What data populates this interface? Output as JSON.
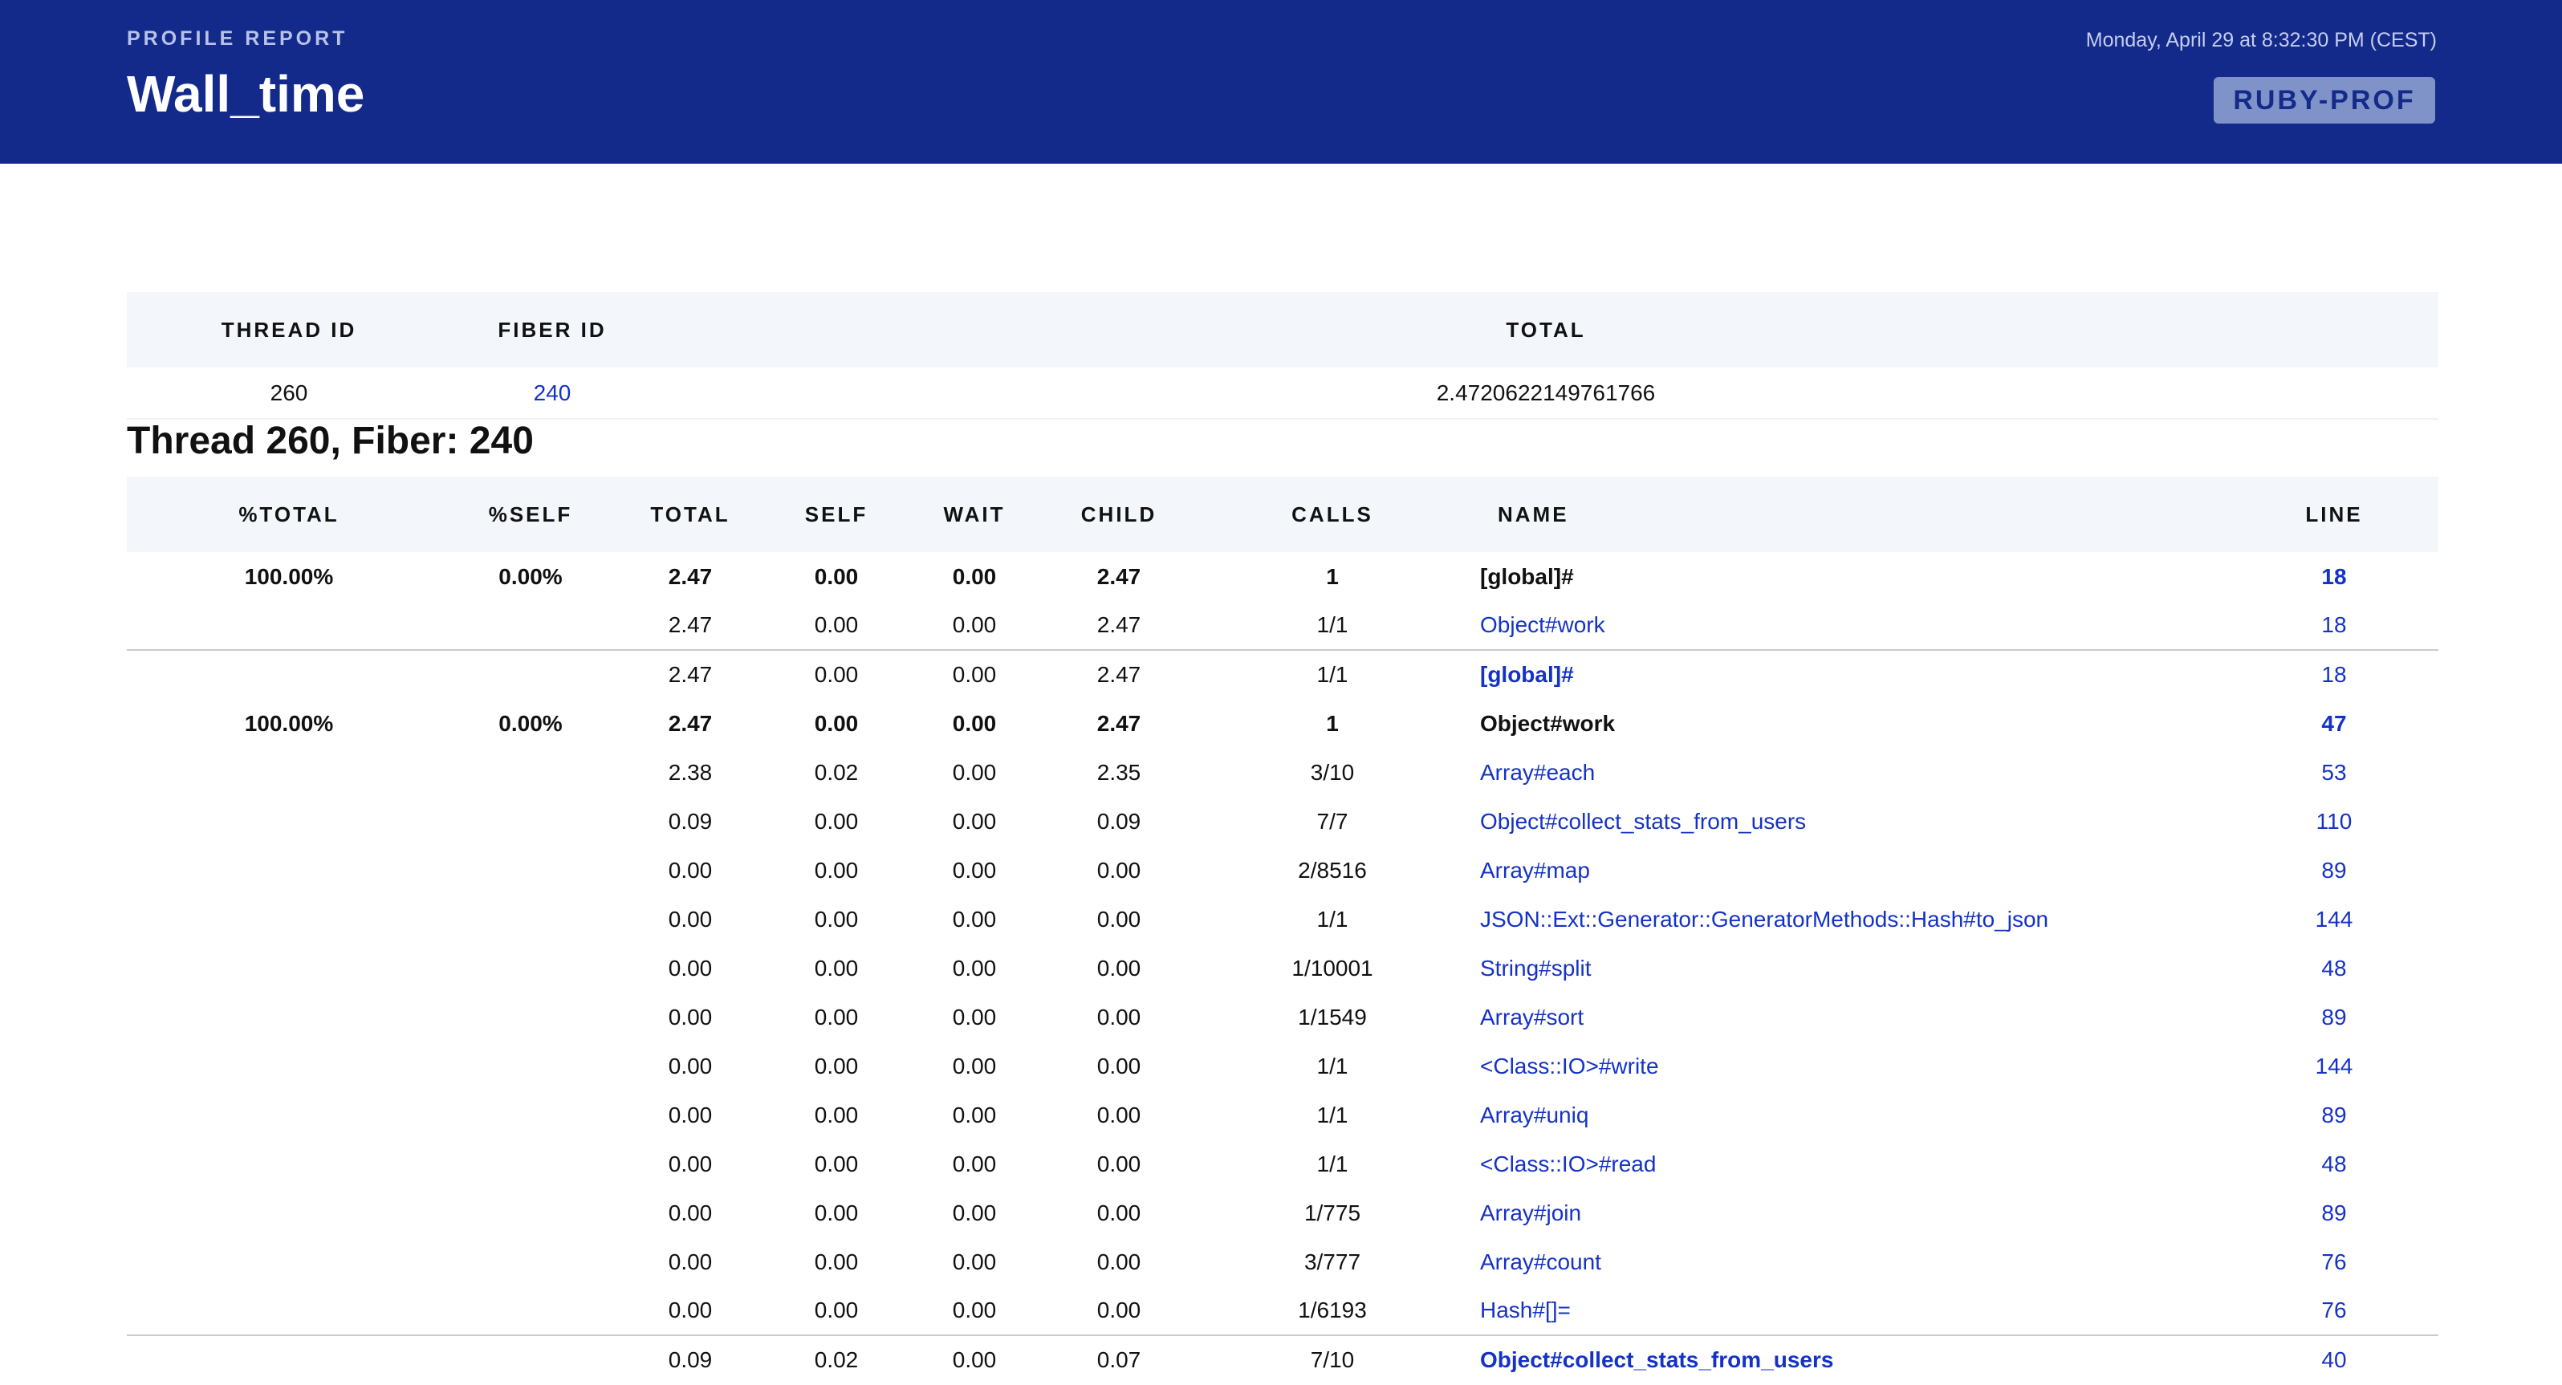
{
  "header": {
    "kicker": "PROFILE REPORT",
    "title": "Wall_time",
    "date": "Monday, April 29 at 8:32:30 PM (CEST)",
    "logo": "RUBY-PROF"
  },
  "thread_table": {
    "headers": [
      "THREAD ID",
      "FIBER ID",
      "TOTAL"
    ],
    "row": {
      "thread_id": "260",
      "fiber_id": "240",
      "total": "2.4720622149761766"
    }
  },
  "section_title": "Thread 260, Fiber: 240",
  "profile_table": {
    "headers": {
      "total_pct": "%TOTAL",
      "self_pct": "%SELF",
      "total": "TOTAL",
      "self": "SELF",
      "wait": "WAIT",
      "child": "CHILD",
      "calls": "CALLS",
      "name": "NAME",
      "line": "LINE"
    },
    "rows": [
      {
        "pct_total": "100.00%",
        "pct_self": "0.00%",
        "total": "2.47",
        "self": "0.00",
        "wait": "0.00",
        "child": "2.47",
        "calls": "1",
        "name": "[global]#",
        "line": "18"
      },
      {
        "pct_total": "",
        "pct_self": "",
        "total": "2.47",
        "self": "0.00",
        "wait": "0.00",
        "child": "2.47",
        "calls": "1/1",
        "name": "Object#work",
        "line": "18"
      },
      {
        "pct_total": "",
        "pct_self": "",
        "total": "2.47",
        "self": "0.00",
        "wait": "0.00",
        "child": "2.47",
        "calls": "1/1",
        "name": "[global]#",
        "line": "18"
      },
      {
        "pct_total": "100.00%",
        "pct_self": "0.00%",
        "total": "2.47",
        "self": "0.00",
        "wait": "0.00",
        "child": "2.47",
        "calls": "1",
        "name": "Object#work",
        "line": "47"
      },
      {
        "pct_total": "",
        "pct_self": "",
        "total": "2.38",
        "self": "0.02",
        "wait": "0.00",
        "child": "2.35",
        "calls": "3/10",
        "name": "Array#each",
        "line": "53"
      },
      {
        "pct_total": "",
        "pct_self": "",
        "total": "0.09",
        "self": "0.00",
        "wait": "0.00",
        "child": "0.09",
        "calls": "7/7",
        "name": "Object#collect_stats_from_users",
        "line": "110"
      },
      {
        "pct_total": "",
        "pct_self": "",
        "total": "0.00",
        "self": "0.00",
        "wait": "0.00",
        "child": "0.00",
        "calls": "2/8516",
        "name": "Array#map",
        "line": "89"
      },
      {
        "pct_total": "",
        "pct_self": "",
        "total": "0.00",
        "self": "0.00",
        "wait": "0.00",
        "child": "0.00",
        "calls": "1/1",
        "name": "JSON::Ext::Generator::GeneratorMethods::Hash#to_json",
        "line": "144"
      },
      {
        "pct_total": "",
        "pct_self": "",
        "total": "0.00",
        "self": "0.00",
        "wait": "0.00",
        "child": "0.00",
        "calls": "1/10001",
        "name": "String#split",
        "line": "48"
      },
      {
        "pct_total": "",
        "pct_self": "",
        "total": "0.00",
        "self": "0.00",
        "wait": "0.00",
        "child": "0.00",
        "calls": "1/1549",
        "name": "Array#sort",
        "line": "89"
      },
      {
        "pct_total": "",
        "pct_self": "",
        "total": "0.00",
        "self": "0.00",
        "wait": "0.00",
        "child": "0.00",
        "calls": "1/1",
        "name": "<Class::IO>#write",
        "line": "144"
      },
      {
        "pct_total": "",
        "pct_self": "",
        "total": "0.00",
        "self": "0.00",
        "wait": "0.00",
        "child": "0.00",
        "calls": "1/1",
        "name": "Array#uniq",
        "line": "89"
      },
      {
        "pct_total": "",
        "pct_self": "",
        "total": "0.00",
        "self": "0.00",
        "wait": "0.00",
        "child": "0.00",
        "calls": "1/1",
        "name": "<Class::IO>#read",
        "line": "48"
      },
      {
        "pct_total": "",
        "pct_self": "",
        "total": "0.00",
        "self": "0.00",
        "wait": "0.00",
        "child": "0.00",
        "calls": "1/775",
        "name": "Array#join",
        "line": "89"
      },
      {
        "pct_total": "",
        "pct_self": "",
        "total": "0.00",
        "self": "0.00",
        "wait": "0.00",
        "child": "0.00",
        "calls": "3/777",
        "name": "Array#count",
        "line": "76"
      },
      {
        "pct_total": "",
        "pct_self": "",
        "total": "0.00",
        "self": "0.00",
        "wait": "0.00",
        "child": "0.00",
        "calls": "1/6193",
        "name": "Hash#[]=",
        "line": "76"
      },
      {
        "pct_total": "",
        "pct_self": "",
        "total": "0.09",
        "self": "0.02",
        "wait": "0.00",
        "child": "0.07",
        "calls": "7/10",
        "name": "Object#collect_stats_from_users",
        "line": "40"
      }
    ]
  }
}
